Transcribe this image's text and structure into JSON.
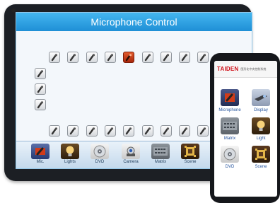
{
  "tablet": {
    "title": "Microphone Control",
    "microphones": {
      "top_count": 9,
      "bottom_count": 9,
      "left_count": 3,
      "active_index": 4,
      "colors": {
        "idle": "#e6e8eb",
        "active": "#c23a16"
      }
    },
    "dock": [
      {
        "label": "Mic.",
        "icon": "microphone-icon"
      },
      {
        "label": "Lights",
        "icon": "bulb-icon"
      },
      {
        "label": "DVD",
        "icon": "disc-icon"
      },
      {
        "label": "Camera",
        "icon": "camera-icon"
      },
      {
        "label": "Matrix",
        "icon": "matrix-icon"
      },
      {
        "label": "Scene",
        "icon": "scene-icon"
      }
    ]
  },
  "phone": {
    "brand": "TAIDEN",
    "brand_subtitle": "图形化中央控制系统",
    "apps": [
      {
        "label": "Microphone",
        "icon": "microphone-icon"
      },
      {
        "label": "Display",
        "icon": "projector-icon"
      },
      {
        "label": "Matrix",
        "icon": "matrix-icon"
      },
      {
        "label": "Light",
        "icon": "bulb-icon"
      },
      {
        "label": "DVD",
        "icon": "disc-icon"
      },
      {
        "label": "Scene",
        "icon": "scene-icon"
      }
    ]
  },
  "colors": {
    "header": "#2a9fe2",
    "brand_red": "#d01018",
    "label_blue": "#1f4f9a"
  }
}
